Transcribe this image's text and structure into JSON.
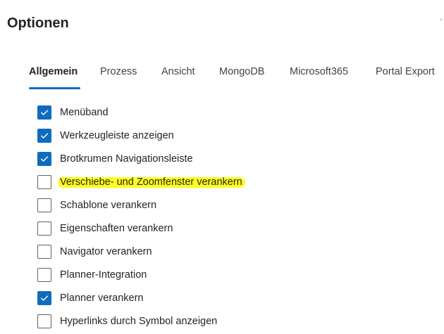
{
  "page": {
    "title": "Optionen",
    "corner_glyph": "∕"
  },
  "tabs": [
    {
      "label": "Allgemein",
      "active": true
    },
    {
      "label": "Prozess",
      "active": false
    },
    {
      "label": "Ansicht",
      "active": false
    },
    {
      "label": "MongoDB",
      "active": false
    },
    {
      "label": "Microsoft365",
      "active": false
    },
    {
      "label": "Portal Export",
      "active": false
    }
  ],
  "options": [
    {
      "label": "Menüband",
      "checked": true
    },
    {
      "label": "Werkzeugleiste anzeigen",
      "checked": true
    },
    {
      "label": "Brotkrumen Navigationsleiste",
      "checked": true
    },
    {
      "label": "Verschiebe- und Zoomfenster verankern",
      "checked": false,
      "highlighted": true
    },
    {
      "label": "Schablone verankern",
      "checked": false
    },
    {
      "label": "Eigenschaften verankern",
      "checked": false
    },
    {
      "label": "Navigator verankern",
      "checked": false
    },
    {
      "label": "Planner-Integration",
      "checked": false
    },
    {
      "label": "Planner verankern",
      "checked": true
    },
    {
      "label": "Hyperlinks durch Symbol anzeigen",
      "checked": false
    }
  ],
  "colors": {
    "accent": "#0f6cbd",
    "highlight": "#ffff1e"
  }
}
